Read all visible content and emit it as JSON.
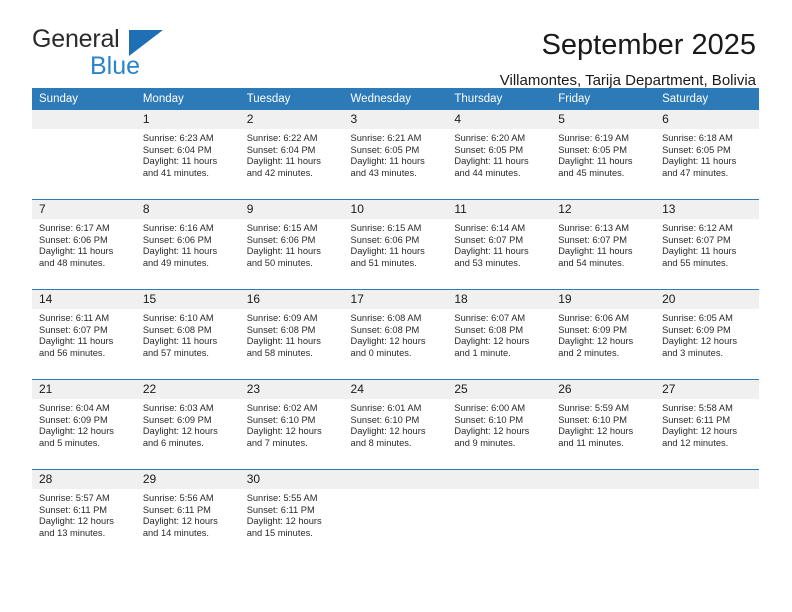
{
  "logo": {
    "word1": "General",
    "word2": "Blue",
    "triangle_color": "#1f6fb5",
    "blue_color": "#2a84cc"
  },
  "header": {
    "title": "September 2025",
    "subtitle": "Villamontes, Tarija Department, Bolivia"
  },
  "theme": {
    "header_blue": "#2d7ab8",
    "daynum_gray": "#f0f0f0",
    "text": "#1a1a1a"
  },
  "calendar": {
    "weekday_headers": [
      "Sunday",
      "Monday",
      "Tuesday",
      "Wednesday",
      "Thursday",
      "Friday",
      "Saturday"
    ],
    "weeks": [
      [
        {
          "day": "",
          "sunrise": "",
          "sunset": "",
          "daylight": ""
        },
        {
          "day": "1",
          "sunrise": "Sunrise: 6:23 AM",
          "sunset": "Sunset: 6:04 PM",
          "daylight": "Daylight: 11 hours and 41 minutes."
        },
        {
          "day": "2",
          "sunrise": "Sunrise: 6:22 AM",
          "sunset": "Sunset: 6:04 PM",
          "daylight": "Daylight: 11 hours and 42 minutes."
        },
        {
          "day": "3",
          "sunrise": "Sunrise: 6:21 AM",
          "sunset": "Sunset: 6:05 PM",
          "daylight": "Daylight: 11 hours and 43 minutes."
        },
        {
          "day": "4",
          "sunrise": "Sunrise: 6:20 AM",
          "sunset": "Sunset: 6:05 PM",
          "daylight": "Daylight: 11 hours and 44 minutes."
        },
        {
          "day": "5",
          "sunrise": "Sunrise: 6:19 AM",
          "sunset": "Sunset: 6:05 PM",
          "daylight": "Daylight: 11 hours and 45 minutes."
        },
        {
          "day": "6",
          "sunrise": "Sunrise: 6:18 AM",
          "sunset": "Sunset: 6:05 PM",
          "daylight": "Daylight: 11 hours and 47 minutes."
        }
      ],
      [
        {
          "day": "7",
          "sunrise": "Sunrise: 6:17 AM",
          "sunset": "Sunset: 6:06 PM",
          "daylight": "Daylight: 11 hours and 48 minutes."
        },
        {
          "day": "8",
          "sunrise": "Sunrise: 6:16 AM",
          "sunset": "Sunset: 6:06 PM",
          "daylight": "Daylight: 11 hours and 49 minutes."
        },
        {
          "day": "9",
          "sunrise": "Sunrise: 6:15 AM",
          "sunset": "Sunset: 6:06 PM",
          "daylight": "Daylight: 11 hours and 50 minutes."
        },
        {
          "day": "10",
          "sunrise": "Sunrise: 6:15 AM",
          "sunset": "Sunset: 6:06 PM",
          "daylight": "Daylight: 11 hours and 51 minutes."
        },
        {
          "day": "11",
          "sunrise": "Sunrise: 6:14 AM",
          "sunset": "Sunset: 6:07 PM",
          "daylight": "Daylight: 11 hours and 53 minutes."
        },
        {
          "day": "12",
          "sunrise": "Sunrise: 6:13 AM",
          "sunset": "Sunset: 6:07 PM",
          "daylight": "Daylight: 11 hours and 54 minutes."
        },
        {
          "day": "13",
          "sunrise": "Sunrise: 6:12 AM",
          "sunset": "Sunset: 6:07 PM",
          "daylight": "Daylight: 11 hours and 55 minutes."
        }
      ],
      [
        {
          "day": "14",
          "sunrise": "Sunrise: 6:11 AM",
          "sunset": "Sunset: 6:07 PM",
          "daylight": "Daylight: 11 hours and 56 minutes."
        },
        {
          "day": "15",
          "sunrise": "Sunrise: 6:10 AM",
          "sunset": "Sunset: 6:08 PM",
          "daylight": "Daylight: 11 hours and 57 minutes."
        },
        {
          "day": "16",
          "sunrise": "Sunrise: 6:09 AM",
          "sunset": "Sunset: 6:08 PM",
          "daylight": "Daylight: 11 hours and 58 minutes."
        },
        {
          "day": "17",
          "sunrise": "Sunrise: 6:08 AM",
          "sunset": "Sunset: 6:08 PM",
          "daylight": "Daylight: 12 hours and 0 minutes."
        },
        {
          "day": "18",
          "sunrise": "Sunrise: 6:07 AM",
          "sunset": "Sunset: 6:08 PM",
          "daylight": "Daylight: 12 hours and 1 minute."
        },
        {
          "day": "19",
          "sunrise": "Sunrise: 6:06 AM",
          "sunset": "Sunset: 6:09 PM",
          "daylight": "Daylight: 12 hours and 2 minutes."
        },
        {
          "day": "20",
          "sunrise": "Sunrise: 6:05 AM",
          "sunset": "Sunset: 6:09 PM",
          "daylight": "Daylight: 12 hours and 3 minutes."
        }
      ],
      [
        {
          "day": "21",
          "sunrise": "Sunrise: 6:04 AM",
          "sunset": "Sunset: 6:09 PM",
          "daylight": "Daylight: 12 hours and 5 minutes."
        },
        {
          "day": "22",
          "sunrise": "Sunrise: 6:03 AM",
          "sunset": "Sunset: 6:09 PM",
          "daylight": "Daylight: 12 hours and 6 minutes."
        },
        {
          "day": "23",
          "sunrise": "Sunrise: 6:02 AM",
          "sunset": "Sunset: 6:10 PM",
          "daylight": "Daylight: 12 hours and 7 minutes."
        },
        {
          "day": "24",
          "sunrise": "Sunrise: 6:01 AM",
          "sunset": "Sunset: 6:10 PM",
          "daylight": "Daylight: 12 hours and 8 minutes."
        },
        {
          "day": "25",
          "sunrise": "Sunrise: 6:00 AM",
          "sunset": "Sunset: 6:10 PM",
          "daylight": "Daylight: 12 hours and 9 minutes."
        },
        {
          "day": "26",
          "sunrise": "Sunrise: 5:59 AM",
          "sunset": "Sunset: 6:10 PM",
          "daylight": "Daylight: 12 hours and 11 minutes."
        },
        {
          "day": "27",
          "sunrise": "Sunrise: 5:58 AM",
          "sunset": "Sunset: 6:11 PM",
          "daylight": "Daylight: 12 hours and 12 minutes."
        }
      ],
      [
        {
          "day": "28",
          "sunrise": "Sunrise: 5:57 AM",
          "sunset": "Sunset: 6:11 PM",
          "daylight": "Daylight: 12 hours and 13 minutes."
        },
        {
          "day": "29",
          "sunrise": "Sunrise: 5:56 AM",
          "sunset": "Sunset: 6:11 PM",
          "daylight": "Daylight: 12 hours and 14 minutes."
        },
        {
          "day": "30",
          "sunrise": "Sunrise: 5:55 AM",
          "sunset": "Sunset: 6:11 PM",
          "daylight": "Daylight: 12 hours and 15 minutes."
        },
        {
          "day": "",
          "sunrise": "",
          "sunset": "",
          "daylight": ""
        },
        {
          "day": "",
          "sunrise": "",
          "sunset": "",
          "daylight": ""
        },
        {
          "day": "",
          "sunrise": "",
          "sunset": "",
          "daylight": ""
        },
        {
          "day": "",
          "sunrise": "",
          "sunset": "",
          "daylight": ""
        }
      ]
    ]
  }
}
